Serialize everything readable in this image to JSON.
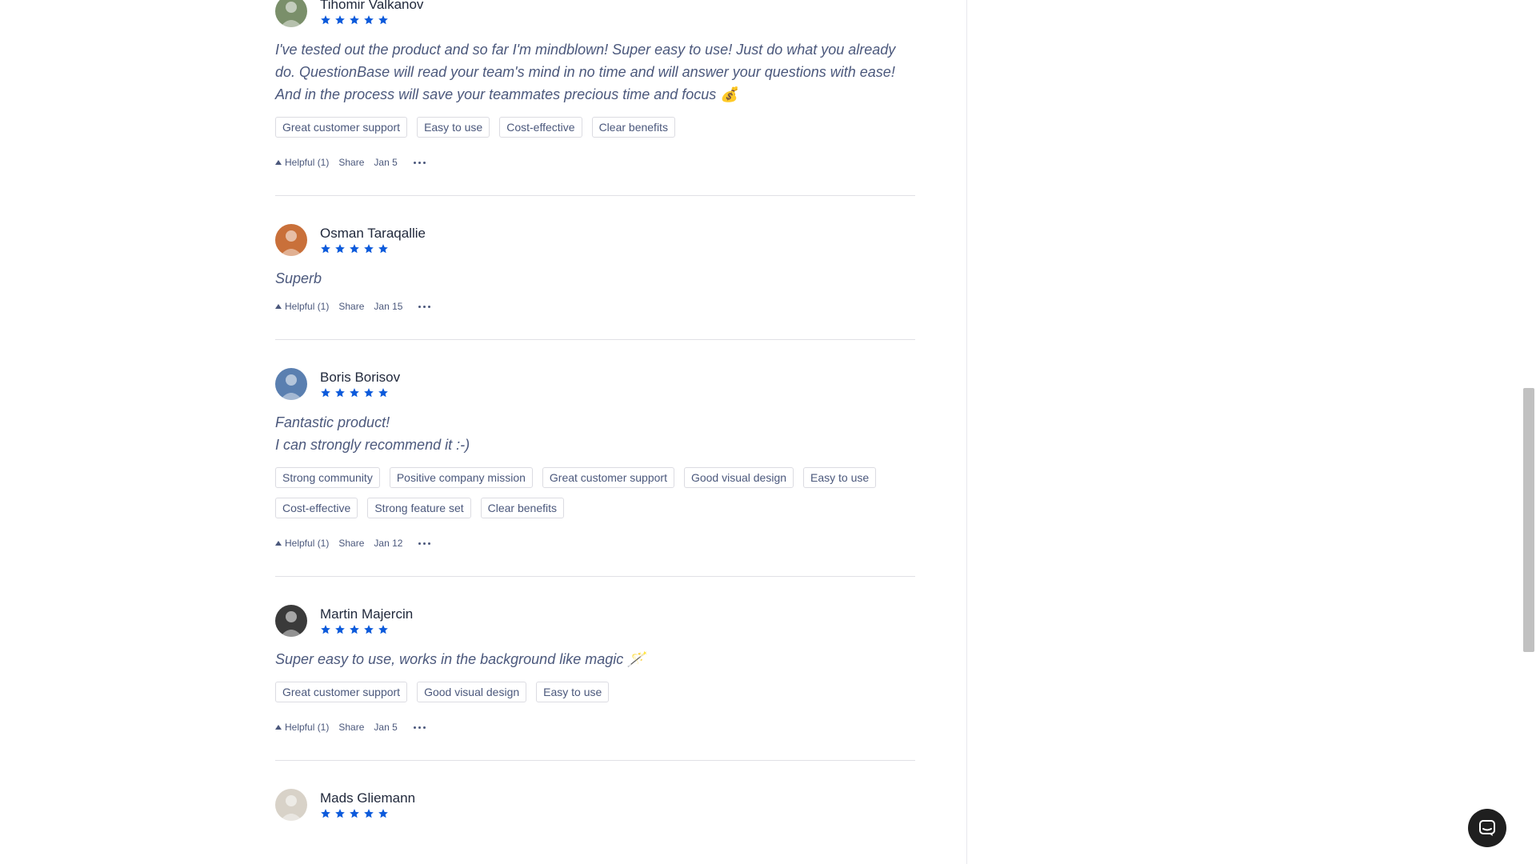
{
  "reviews": [
    {
      "author": "Tihomir Valkanov",
      "rating": 5,
      "body": "I've tested out the product and so far I'm mindblown! Super easy to use! Just do what you already do. QuestionBase will read your team's mind in no time and will answer your questions with ease! And in the process will save your teammates precious time and focus 💰",
      "tags": [
        "Great customer support",
        "Easy to use",
        "Cost-effective",
        "Clear benefits"
      ],
      "helpful": "Helpful (1)",
      "share": "Share",
      "date": "Jan 5",
      "avatar_color": "#7a8f6a"
    },
    {
      "author": "Osman Taraqallie",
      "rating": 5,
      "body": "Superb",
      "tags": [],
      "helpful": "Helpful (1)",
      "share": "Share",
      "date": "Jan 15",
      "avatar_color": "#c9703a"
    },
    {
      "author": "Boris Borisov",
      "rating": 5,
      "body": "Fantastic product!\nI can strongly recommend it :-)",
      "tags": [
        "Strong community",
        "Positive company mission",
        "Great customer support",
        "Good visual design",
        "Easy to use",
        "Cost-effective",
        "Strong feature set",
        "Clear benefits"
      ],
      "helpful": "Helpful (1)",
      "share": "Share",
      "date": "Jan 12",
      "avatar_color": "#5a7fb0"
    },
    {
      "author": "Martin Majercin",
      "rating": 5,
      "body": "Super easy to use, works in the background like magic 🪄",
      "tags": [
        "Great customer support",
        "Good visual design",
        "Easy to use"
      ],
      "helpful": "Helpful (1)",
      "share": "Share",
      "date": "Jan 5",
      "avatar_color": "#3a3a3a"
    },
    {
      "author": "Mads Gliemann",
      "rating": 5,
      "body": "",
      "tags": [],
      "helpful": "",
      "share": "",
      "date": "",
      "avatar_color": "#d8d2c8"
    }
  ],
  "colors": {
    "star": "#0c5adb",
    "text_primary": "#21293c",
    "text_secondary": "#4b587c"
  },
  "icons": {
    "helpful": "arrow-up-icon",
    "more": "more-icon",
    "chat": "chat-icon"
  }
}
